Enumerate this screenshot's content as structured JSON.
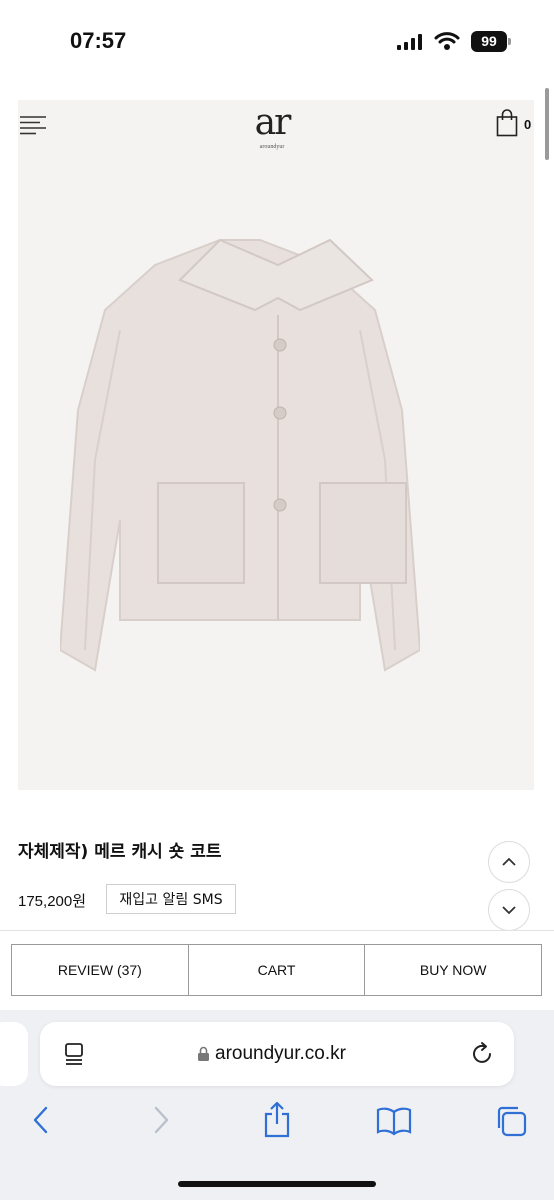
{
  "status_bar": {
    "time": "07:57",
    "battery": "99"
  },
  "header": {
    "logo_mark": "ar",
    "logo_sub": "aroundyur",
    "cart_count": "0"
  },
  "product": {
    "title": "자체제작) 메르 캐시 숏 코트",
    "price": "175,200원",
    "restock_button": "재입고 알림 SMS"
  },
  "actions": {
    "review": "REVIEW (37)",
    "cart": "CART",
    "buy_now": "BUY NOW"
  },
  "browser": {
    "url": "aroundyur.co.kr"
  },
  "icons": [
    "menu-icon",
    "shopping-bag-icon",
    "chevron-up-icon",
    "chevron-down-icon",
    "reader-icon",
    "lock-icon",
    "reload-icon",
    "back-icon",
    "forward-icon",
    "share-icon",
    "bookmarks-icon",
    "tabs-icon",
    "signal-icon",
    "wifi-icon",
    "battery-icon"
  ],
  "colors": {
    "accent": "#2f6fd6",
    "image_background": "#f4f3f2",
    "coat": "#e7e0dd"
  }
}
